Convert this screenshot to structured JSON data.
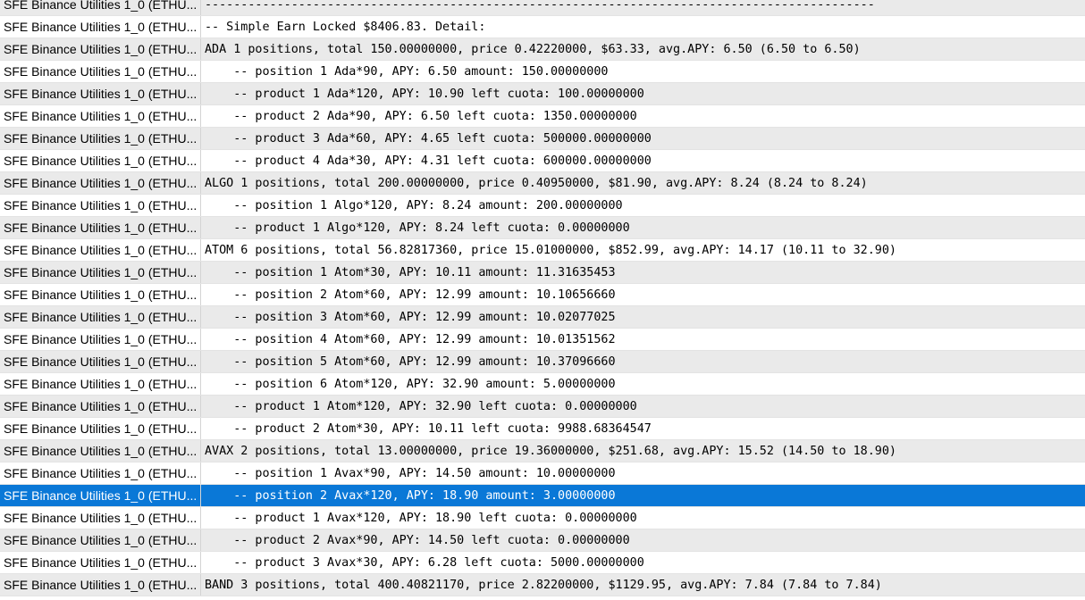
{
  "colors": {
    "row_odd": "#eaeaea",
    "row_even": "#ffffff",
    "selected": "#0a78d7",
    "selected_text": "#ffffff"
  },
  "selected_row": 22,
  "rows": [
    {
      "source": "SFE Binance Utilities 1_0 (ETHU...",
      "message": "---------------------------------------------------------------------------------------------"
    },
    {
      "source": "SFE Binance Utilities 1_0 (ETHU...",
      "message": "-- Simple Earn Locked $8406.83. Detail:"
    },
    {
      "source": "SFE Binance Utilities 1_0 (ETHU...",
      "message": "ADA 1 positions, total 150.00000000, price 0.42220000, $63.33, avg.APY: 6.50 (6.50 to 6.50)"
    },
    {
      "source": "SFE Binance Utilities 1_0 (ETHU...",
      "message": "    -- position 1 Ada*90, APY: 6.50 amount: 150.00000000"
    },
    {
      "source": "SFE Binance Utilities 1_0 (ETHU...",
      "message": "    -- product 1 Ada*120, APY: 10.90 left cuota: 100.00000000"
    },
    {
      "source": "SFE Binance Utilities 1_0 (ETHU...",
      "message": "    -- product 2 Ada*90, APY: 6.50 left cuota: 1350.00000000"
    },
    {
      "source": "SFE Binance Utilities 1_0 (ETHU...",
      "message": "    -- product 3 Ada*60, APY: 4.65 left cuota: 500000.00000000"
    },
    {
      "source": "SFE Binance Utilities 1_0 (ETHU...",
      "message": "    -- product 4 Ada*30, APY: 4.31 left cuota: 600000.00000000"
    },
    {
      "source": "SFE Binance Utilities 1_0 (ETHU...",
      "message": "ALGO 1 positions, total 200.00000000, price 0.40950000, $81.90, avg.APY: 8.24 (8.24 to 8.24)"
    },
    {
      "source": "SFE Binance Utilities 1_0 (ETHU...",
      "message": "    -- position 1 Algo*120, APY: 8.24 amount: 200.00000000"
    },
    {
      "source": "SFE Binance Utilities 1_0 (ETHU...",
      "message": "    -- product 1 Algo*120, APY: 8.24 left cuota: 0.00000000"
    },
    {
      "source": "SFE Binance Utilities 1_0 (ETHU...",
      "message": "ATOM 6 positions, total 56.82817360, price 15.01000000, $852.99, avg.APY: 14.17 (10.11 to 32.90)"
    },
    {
      "source": "SFE Binance Utilities 1_0 (ETHU...",
      "message": "    -- position 1 Atom*30, APY: 10.11 amount: 11.31635453"
    },
    {
      "source": "SFE Binance Utilities 1_0 (ETHU...",
      "message": "    -- position 2 Atom*60, APY: 12.99 amount: 10.10656660"
    },
    {
      "source": "SFE Binance Utilities 1_0 (ETHU...",
      "message": "    -- position 3 Atom*60, APY: 12.99 amount: 10.02077025"
    },
    {
      "source": "SFE Binance Utilities 1_0 (ETHU...",
      "message": "    -- position 4 Atom*60, APY: 12.99 amount: 10.01351562"
    },
    {
      "source": "SFE Binance Utilities 1_0 (ETHU...",
      "message": "    -- position 5 Atom*60, APY: 12.99 amount: 10.37096660"
    },
    {
      "source": "SFE Binance Utilities 1_0 (ETHU...",
      "message": "    -- position 6 Atom*120, APY: 32.90 amount: 5.00000000"
    },
    {
      "source": "SFE Binance Utilities 1_0 (ETHU...",
      "message": "    -- product 1 Atom*120, APY: 32.90 left cuota: 0.00000000"
    },
    {
      "source": "SFE Binance Utilities 1_0 (ETHU...",
      "message": "    -- product 2 Atom*30, APY: 10.11 left cuota: 9988.68364547"
    },
    {
      "source": "SFE Binance Utilities 1_0 (ETHU...",
      "message": "AVAX 2 positions, total 13.00000000, price 19.36000000, $251.68, avg.APY: 15.52 (14.50 to 18.90)"
    },
    {
      "source": "SFE Binance Utilities 1_0 (ETHU...",
      "message": "    -- position 1 Avax*90, APY: 14.50 amount: 10.00000000"
    },
    {
      "source": "SFE Binance Utilities 1_0 (ETHU...",
      "message": "    -- position 2 Avax*120, APY: 18.90 amount: 3.00000000"
    },
    {
      "source": "SFE Binance Utilities 1_0 (ETHU...",
      "message": "    -- product 1 Avax*120, APY: 18.90 left cuota: 0.00000000"
    },
    {
      "source": "SFE Binance Utilities 1_0 (ETHU...",
      "message": "    -- product 2 Avax*90, APY: 14.50 left cuota: 0.00000000"
    },
    {
      "source": "SFE Binance Utilities 1_0 (ETHU...",
      "message": "    -- product 3 Avax*30, APY: 6.28 left cuota: 5000.00000000"
    },
    {
      "source": "SFE Binance Utilities 1_0 (ETHU...",
      "message": "BAND 3 positions, total 400.40821170, price 2.82200000, $1129.95, avg.APY: 7.84 (7.84 to 7.84)"
    }
  ]
}
